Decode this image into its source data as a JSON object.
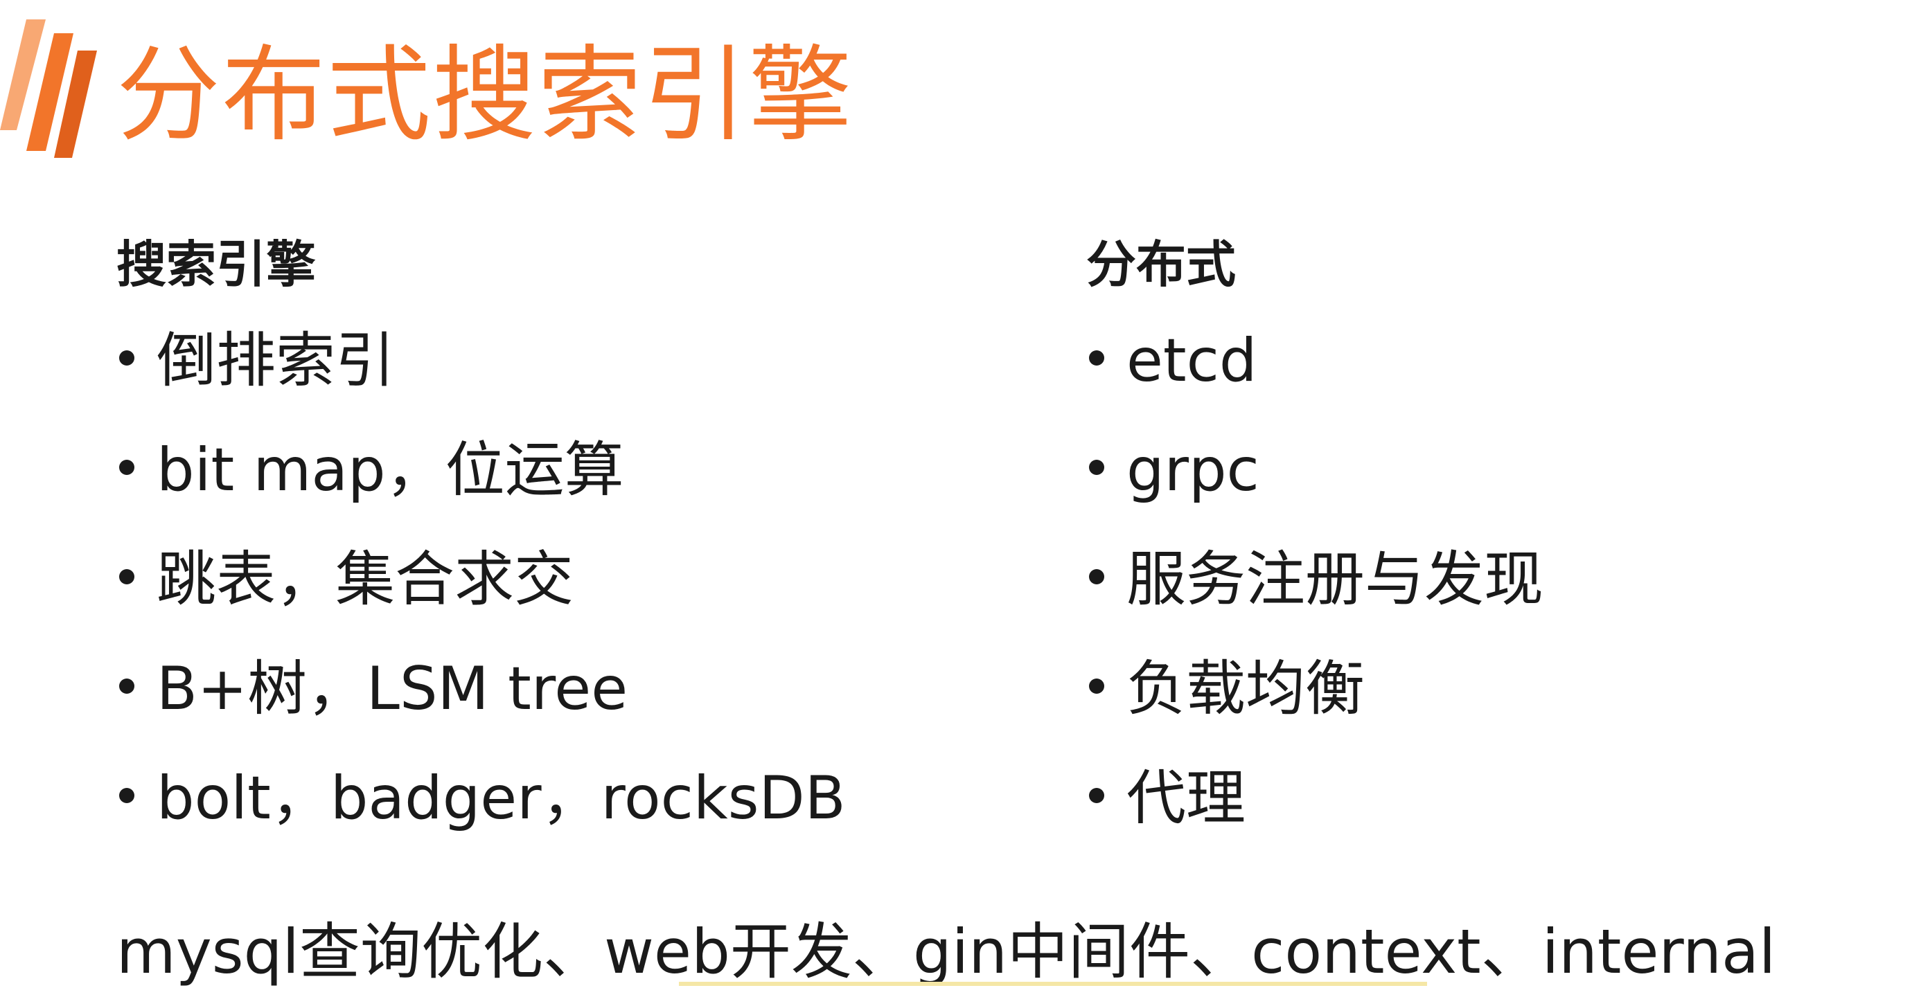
{
  "slide": {
    "title": "分布式搜索引擎",
    "accent_color": "#f2752a",
    "logo_icon": "orange-slash-stripes"
  },
  "left_column": {
    "heading": "搜索引擎",
    "items": [
      "倒排索引",
      "bit map，位运算",
      "跳表，集合求交",
      "B+树，LSM tree",
      "bolt，badger，rocksDB"
    ]
  },
  "right_column": {
    "heading": "分布式",
    "items": [
      "etcd",
      "grpc",
      "服务注册与发现",
      "负载均衡",
      "代理"
    ]
  },
  "footer": {
    "text": "mysql查询优化、web开发、gin中间件、context、internal"
  }
}
